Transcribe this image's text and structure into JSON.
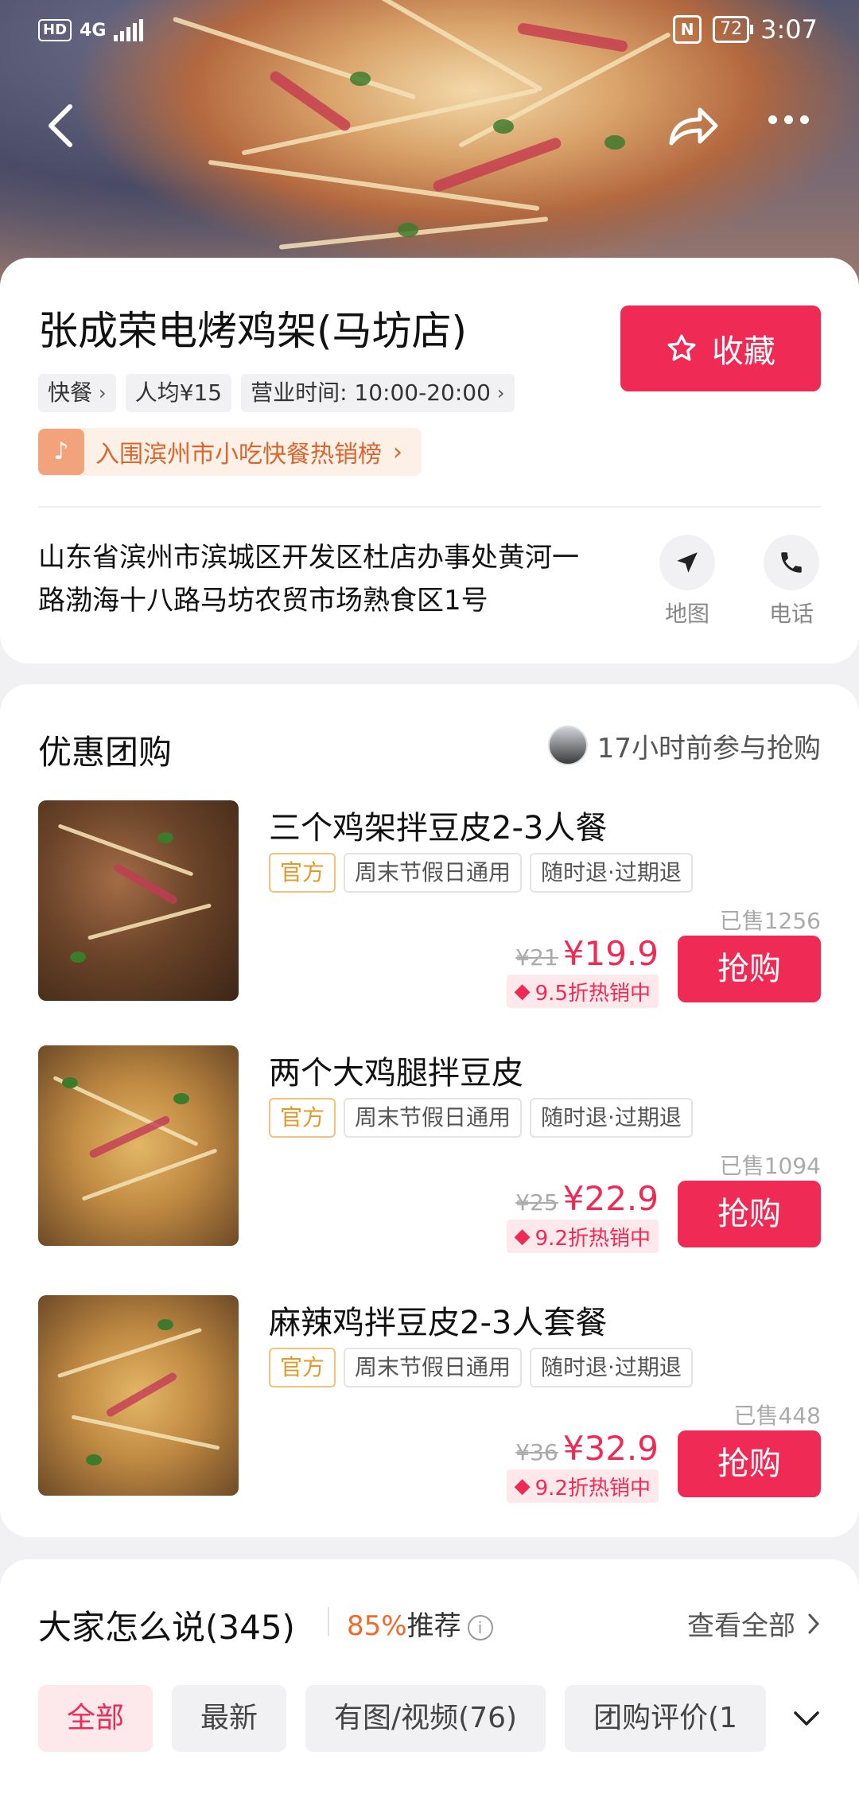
{
  "status_bar": {
    "hd": "HD",
    "network": "4G",
    "battery": "72",
    "time": "3:07"
  },
  "shop": {
    "name": "张成荣电烤鸡架(马坊店)",
    "favorite_label": "收藏",
    "tags": [
      {
        "label": "快餐"
      },
      {
        "label": "人均¥15"
      },
      {
        "label": "营业时间: 10:00-20:00"
      }
    ],
    "rank_label": "入围滨州市小吃快餐热销榜",
    "address": "山东省滨州市滨城区开发区杜店办事处黄河一路渤海十八路马坊农贸市场熟食区1号",
    "map_label": "地图",
    "phone_label": "电话"
  },
  "deals": {
    "section_title": "优惠团购",
    "recent_activity": "17小时前参与抢购",
    "items": [
      {
        "title": "三个鸡架拌豆皮2-3人餐",
        "labels": [
          "官方",
          "周末节假日通用",
          "随时退·过期退"
        ],
        "sold": "已售1256",
        "original_price": "¥21",
        "price": "¥19.9",
        "discount": "9.5折热销中",
        "buy_label": "抢购"
      },
      {
        "title": "两个大鸡腿拌豆皮",
        "labels": [
          "官方",
          "周末节假日通用",
          "随时退·过期退"
        ],
        "sold": "已售1094",
        "original_price": "¥25",
        "price": "¥22.9",
        "discount": "9.2折热销中",
        "buy_label": "抢购"
      },
      {
        "title": "麻辣鸡拌豆皮2-3人套餐",
        "labels": [
          "官方",
          "周末节假日通用",
          "随时退·过期退"
        ],
        "sold": "已售448",
        "original_price": "¥36",
        "price": "¥32.9",
        "discount": "9.2折热销中",
        "buy_label": "抢购"
      }
    ]
  },
  "reviews": {
    "title": "大家怎么说(345)",
    "recommend_pct": "85%",
    "recommend_label": "推荐",
    "view_all": "查看全部",
    "tabs": [
      {
        "label": "全部"
      },
      {
        "label": "最新"
      },
      {
        "label": "有图/视频(76)"
      },
      {
        "label": "团购评价(1"
      }
    ]
  },
  "colors": {
    "accent": "#ee2a55",
    "recommend": "#f06a2d",
    "official": "#e39a2a"
  }
}
